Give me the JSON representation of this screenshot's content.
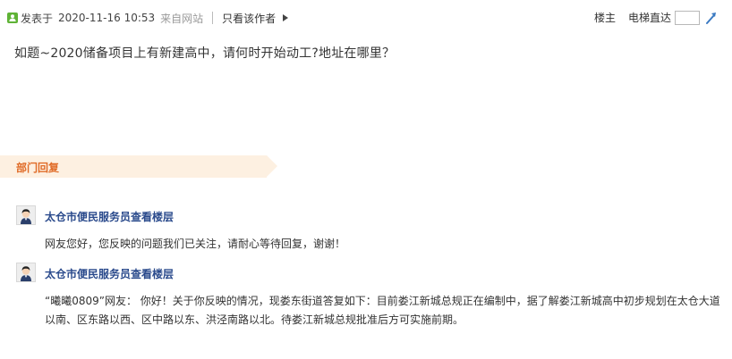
{
  "post_meta": {
    "posted_prefix": "发表于",
    "posted_time": "2020-11-16 10:53",
    "posted_source": "来自网站",
    "only_author_label": "只看该作者"
  },
  "floor_nav": {
    "floor_owner_label": "楼主",
    "elevator_label": "电梯直达",
    "floor_input_value": ""
  },
  "question": {
    "text": "如题~2020储备项目上有新建高中，请何时开始动工?地址在哪里？"
  },
  "section": {
    "title": "部门回复"
  },
  "replies": [
    {
      "author": "太仓市便民服务员查看楼层",
      "text": "网友您好，您反映的问题我们已关注，请耐心等待回复，谢谢！"
    },
    {
      "author": "太仓市便民服务员查看楼层",
      "text": "“曦曦0809”网友： 你好！关于你反映的情况，现娄东街道答复如下：目前娄江新城总规正在编制中，据了解娄江新城高中初步规划在太仓大道以南、区东路以西、区中路以东、洪泾南路以北。待娄江新城总规批准后方可实施前期。"
    }
  ],
  "colors": {
    "online_icon": "#5fb336",
    "section_bg": "#fdf0e1",
    "section_title": "#e06b27",
    "author_link": "#2a4a8c"
  },
  "icons": {
    "online": "online-status-icon",
    "dropdown": "triangle-right-icon",
    "jump": "jump-arrow-icon",
    "avatar": "user-avatar-icon"
  }
}
